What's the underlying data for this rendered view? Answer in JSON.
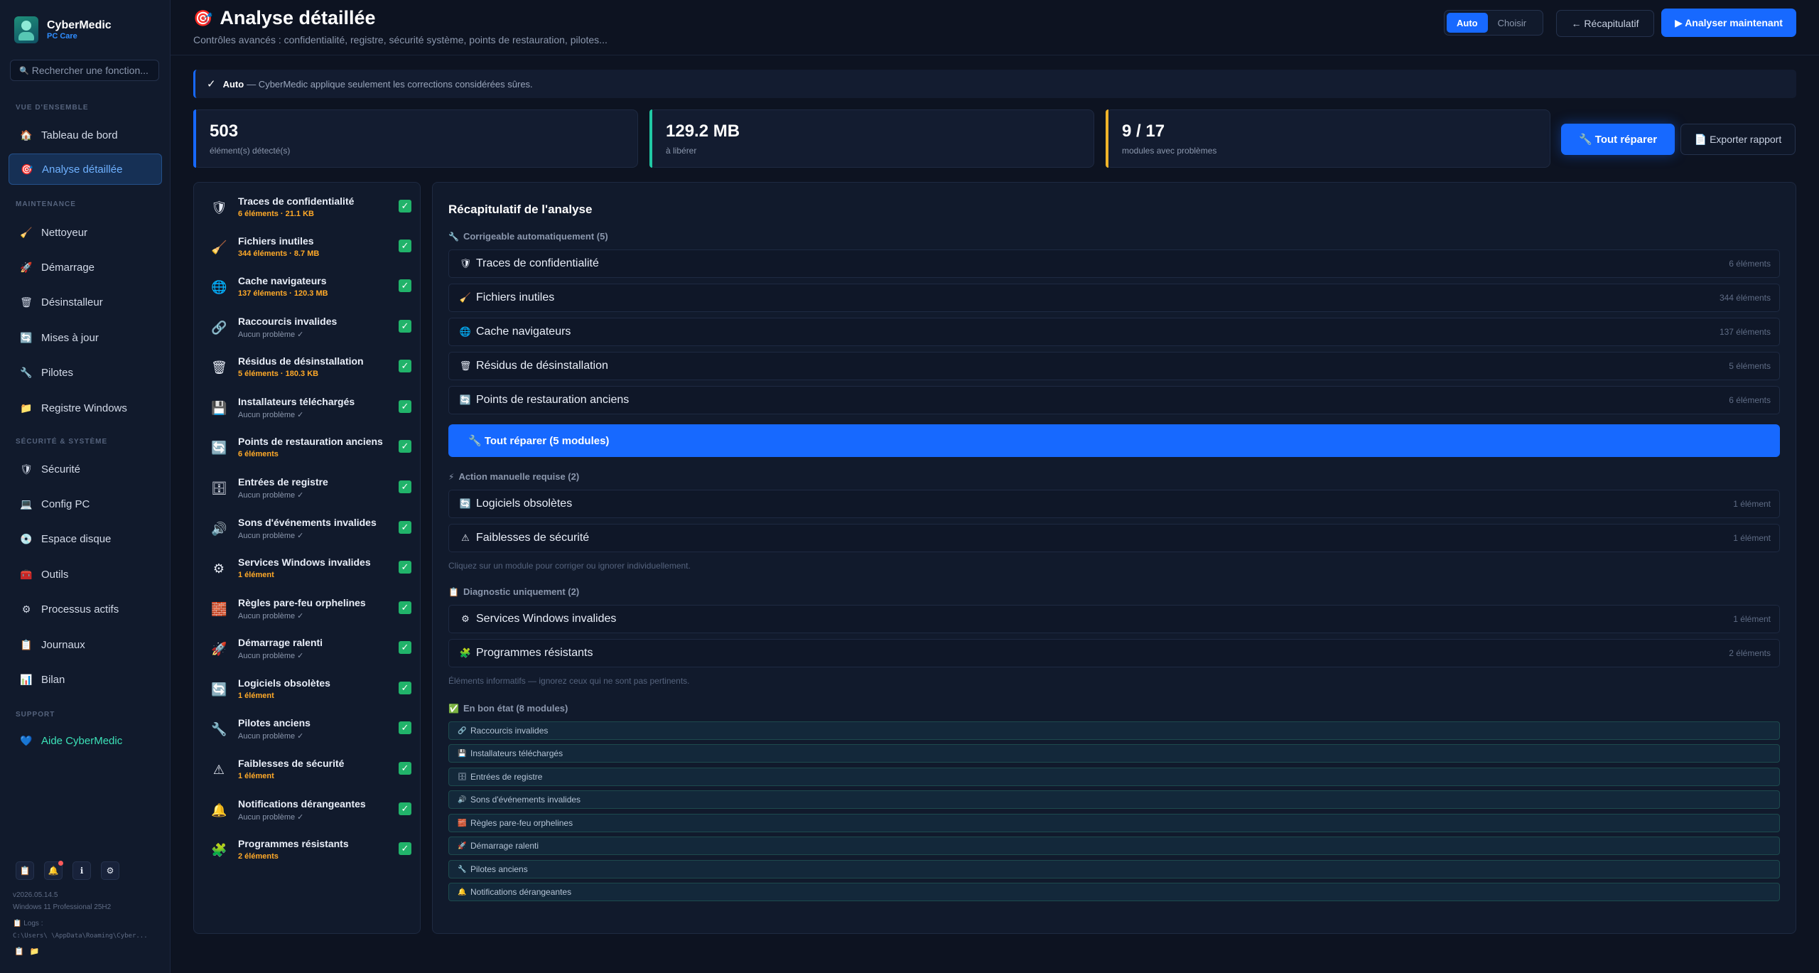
{
  "brand": {
    "name": "CyberMedic",
    "sub": "PC Care"
  },
  "search": {
    "placeholder": "Rechercher une fonction..."
  },
  "sidebar": {
    "sections": [
      "VUE D'ENSEMBLE",
      "MAINTENANCE",
      "SÉCURITÉ & SYSTÈME",
      "SUPPORT"
    ],
    "items": [
      {
        "label": "Tableau de bord",
        "icon": "🏠"
      },
      {
        "label": "Analyse détaillée",
        "icon": "🎯"
      },
      {
        "label": "Nettoyeur",
        "icon": "🧹"
      },
      {
        "label": "Démarrage",
        "icon": "🚀"
      },
      {
        "label": "Désinstalleur",
        "icon": "🗑"
      },
      {
        "label": "Mises à jour",
        "icon": "🔄"
      },
      {
        "label": "Pilotes",
        "icon": "🔧"
      },
      {
        "label": "Registre Windows",
        "icon": "📁"
      },
      {
        "label": "Sécurité",
        "icon": "🛡"
      },
      {
        "label": "Config PC",
        "icon": "💻"
      },
      {
        "label": "Espace disque",
        "icon": "💿"
      },
      {
        "label": "Outils",
        "icon": "🧰"
      },
      {
        "label": "Processus actifs",
        "icon": "⚙"
      },
      {
        "label": "Journaux",
        "icon": "📋"
      },
      {
        "label": "Bilan",
        "icon": "📊"
      },
      {
        "label": "Aide CyberMedic",
        "icon": "💙"
      }
    ],
    "footer": {
      "icons": [
        "📋",
        "🔔",
        "ℹ",
        "⚙"
      ],
      "version": "v2026.05.14.5",
      "os": "Windows 11 Professional 25H2",
      "logs": "📋 Logs :",
      "path": "C:\\Users\\        \\AppData\\Roaming\\Cyber...",
      "mini": [
        "📋",
        "📁"
      ]
    }
  },
  "header": {
    "icon": "🎯",
    "title": "Analyse détaillée",
    "subtitle": "Contrôles avancés : confidentialité, registre, sécurité système, points de restauration, pilotes...",
    "mode_auto": "Auto",
    "mode_choose": "Choisir",
    "recap": "← Récapitulatif",
    "analyze": "▶ Analyser maintenant"
  },
  "infobar": {
    "check": "✓",
    "bold": "Auto",
    "text": "— CyberMedic applique seulement les corrections considérées sûres."
  },
  "stats": [
    {
      "value": "503",
      "label": "élément(s) détecté(s)"
    },
    {
      "value": "129.2 MB",
      "label": "à libérer"
    },
    {
      "value": "9 / 17",
      "label": "modules avec problèmes"
    }
  ],
  "actions": {
    "repair_all": "🔧 Tout réparer",
    "export": "📄 Exporter rapport"
  },
  "modules": [
    {
      "name": "Traces de confidentialité",
      "status": "6 éléments · 21.1 KB",
      "warn": true,
      "icon": "🛡"
    },
    {
      "name": "Fichiers inutiles",
      "status": "344 éléments · 8.7 MB",
      "warn": true,
      "icon": "🧹"
    },
    {
      "name": "Cache navigateurs",
      "status": "137 éléments · 120.3 MB",
      "warn": true,
      "icon": "🌐"
    },
    {
      "name": "Raccourcis invalides",
      "status": "Aucun problème ✓",
      "warn": false,
      "icon": "🔗"
    },
    {
      "name": "Résidus de désinstallation",
      "status": "5 éléments · 180.3 KB",
      "warn": true,
      "icon": "🗑"
    },
    {
      "name": "Installateurs téléchargés",
      "status": "Aucun problème ✓",
      "warn": false,
      "icon": "💾"
    },
    {
      "name": "Points de restauration anciens",
      "status": "6 éléments",
      "warn": true,
      "icon": "🔄"
    },
    {
      "name": "Entrées de registre",
      "status": "Aucun problème ✓",
      "warn": false,
      "icon": "🗄"
    },
    {
      "name": "Sons d'événements invalides",
      "status": "Aucun problème ✓",
      "warn": false,
      "icon": "🔊"
    },
    {
      "name": "Services Windows invalides",
      "status": "1 élément",
      "warn": true,
      "icon": "⚙"
    },
    {
      "name": "Règles pare-feu orphelines",
      "status": "Aucun problème ✓",
      "warn": false,
      "icon": "🧱"
    },
    {
      "name": "Démarrage ralenti",
      "status": "Aucun problème ✓",
      "warn": false,
      "icon": "🚀"
    },
    {
      "name": "Logiciels obsolètes",
      "status": "1 élément",
      "warn": true,
      "icon": "🔄"
    },
    {
      "name": "Pilotes anciens",
      "status": "Aucun problème ✓",
      "warn": false,
      "icon": "🔧"
    },
    {
      "name": "Faiblesses de sécurité",
      "status": "1 élément",
      "warn": true,
      "icon": "⚠"
    },
    {
      "name": "Notifications dérangeantes",
      "status": "Aucun problème ✓",
      "warn": false,
      "icon": "🔔"
    },
    {
      "name": "Programmes résistants",
      "status": "2 éléments",
      "warn": true,
      "icon": "🧩"
    }
  ],
  "check_mark": "✓",
  "summary": {
    "title": "Récapitulatif de l'analyse",
    "auto_group": {
      "icon": "🔧",
      "label": "Corrigeable automatiquement (5)"
    },
    "auto_rows": [
      {
        "icon": "🛡",
        "name": "Traces de confidentialité",
        "count": "6 éléments"
      },
      {
        "icon": "🧹",
        "name": "Fichiers inutiles",
        "count": "344 éléments"
      },
      {
        "icon": "🌐",
        "name": "Cache navigateurs",
        "count": "137 éléments"
      },
      {
        "icon": "🗑",
        "name": "Résidus de désinstallation",
        "count": "5 éléments"
      },
      {
        "icon": "🔄",
        "name": "Points de restauration anciens",
        "count": "6 éléments"
      }
    ],
    "fix_button": "🔧 Tout réparer (5 modules)",
    "manual_group": {
      "icon": "⚡",
      "label": "Action manuelle requise (2)"
    },
    "manual_rows": [
      {
        "icon": "🔄",
        "name": "Logiciels obsolètes",
        "count": "1 élément"
      },
      {
        "icon": "⚠",
        "name": "Faiblesses de sécurité",
        "count": "1 élément"
      }
    ],
    "manual_hint": "Cliquez sur un module pour corriger ou ignorer individuellement.",
    "diag_group": {
      "icon": "📋",
      "label": "Diagnostic uniquement (2)"
    },
    "diag_rows": [
      {
        "icon": "⚙",
        "name": "Services Windows invalides",
        "count": "1 élément"
      },
      {
        "icon": "🧩",
        "name": "Programmes résistants",
        "count": "2 éléments"
      }
    ],
    "diag_hint": "Éléments informatifs — ignorez ceux qui ne sont pas pertinents.",
    "ok_group": {
      "icon": "✅",
      "label": "En bon état (8 modules)"
    },
    "ok_rows": [
      {
        "icon": "🔗",
        "name": "Raccourcis invalides"
      },
      {
        "icon": "💾",
        "name": "Installateurs téléchargés"
      },
      {
        "icon": "🗄",
        "name": "Entrées de registre"
      },
      {
        "icon": "🔊",
        "name": "Sons d'événements invalides"
      },
      {
        "icon": "🧱",
        "name": "Règles pare-feu orphelines"
      },
      {
        "icon": "🚀",
        "name": "Démarrage ralenti"
      },
      {
        "icon": "🔧",
        "name": "Pilotes anciens"
      },
      {
        "icon": "🔔",
        "name": "Notifications dérangeantes"
      }
    ]
  }
}
